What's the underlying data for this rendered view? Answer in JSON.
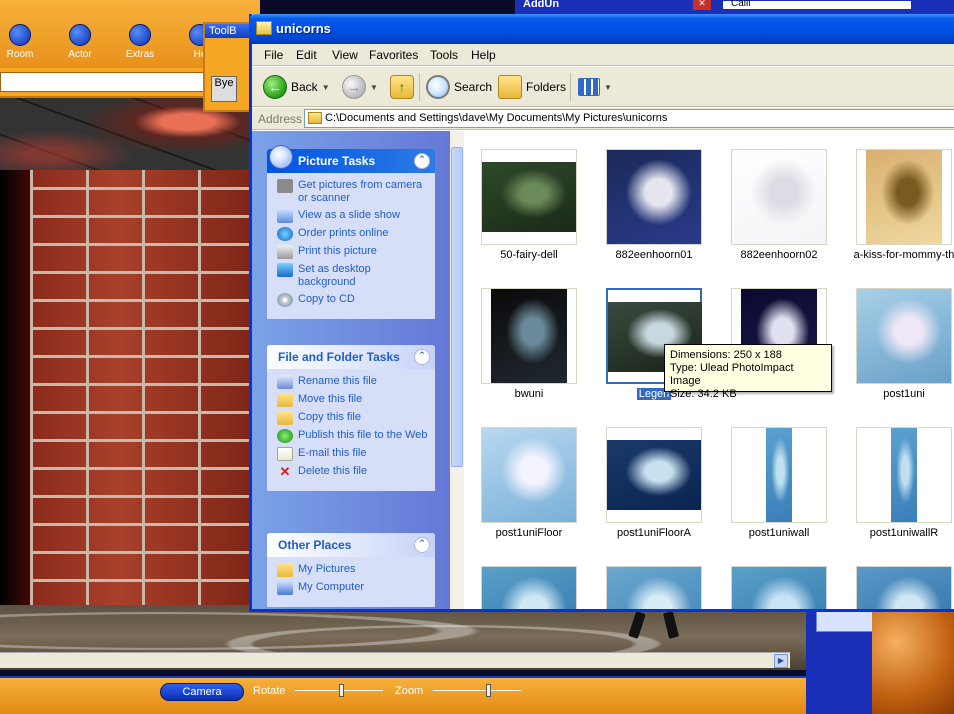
{
  "game": {
    "nav": [
      {
        "label": "Room",
        "icon": "room-icon"
      },
      {
        "label": "Actor",
        "icon": "actor-icon"
      },
      {
        "label": "Extras",
        "icon": "extras-icon"
      },
      {
        "label": "He",
        "icon": "help-icon"
      }
    ],
    "toolbar_title": "ToolB",
    "bye_label": "Bye",
    "addun_title": "AddUn",
    "calli_label": "Calli",
    "bottom": {
      "camera": "Camera",
      "rotate": "Rotate",
      "zoom": "Zoom",
      "rotate_level": 0.52,
      "zoom_level": 0.62
    }
  },
  "explorer": {
    "title": "unicorns",
    "menu": [
      "File",
      "Edit",
      "View",
      "Favorites",
      "Tools",
      "Help"
    ],
    "toolbar": {
      "back": "Back",
      "search": "Search",
      "folders": "Folders"
    },
    "address_label": "Address",
    "address_value": "C:\\Documents and Settings\\dave\\My Documents\\My Pictures\\unicorns",
    "picture_tasks": {
      "title": "Picture Tasks",
      "items": [
        {
          "label": "Get pictures from camera or scanner",
          "icon": "camera-icon"
        },
        {
          "label": "View as a slide show",
          "icon": "slideshow-icon"
        },
        {
          "label": "Order prints online",
          "icon": "globe-icon"
        },
        {
          "label": "Print this picture",
          "icon": "printer-icon"
        },
        {
          "label": "Set as desktop background",
          "icon": "desktop-icon"
        },
        {
          "label": "Copy to CD",
          "icon": "cd-icon"
        }
      ]
    },
    "file_tasks": {
      "title": "File and Folder Tasks",
      "items": [
        {
          "label": "Rename this file",
          "icon": "rename-icon"
        },
        {
          "label": "Move this file",
          "icon": "move-icon"
        },
        {
          "label": "Copy this file",
          "icon": "copy-icon"
        },
        {
          "label": "Publish this file to the Web",
          "icon": "publish-icon"
        },
        {
          "label": "E-mail this file",
          "icon": "mail-icon"
        },
        {
          "label": "Delete this file",
          "icon": "delete-icon"
        }
      ]
    },
    "other_places": {
      "title": "Other Places",
      "items": [
        {
          "label": "My Pictures",
          "icon": "my-pictures-icon"
        },
        {
          "label": "My Computer",
          "icon": "my-computer-icon"
        }
      ]
    },
    "thumbnails": [
      {
        "label": "50-fairy-dell",
        "selected": false,
        "palette": [
          "#2e4a2a",
          "#6a8a5a",
          "#1a2a18"
        ],
        "shape": "wide"
      },
      {
        "label": "882eenhoorn01",
        "selected": false,
        "palette": [
          "#1a2a5a",
          "#e6e6f0",
          "#2a3a8a"
        ],
        "shape": "full"
      },
      {
        "label": "882eenhoorn02",
        "selected": false,
        "palette": [
          "#ffffff",
          "#dcdce4",
          "#f4f4f8"
        ],
        "shape": "full"
      },
      {
        "label": "a-kiss-for-mommy-th",
        "selected": false,
        "palette": [
          "#d8b070",
          "#7a5a20",
          "#f0d8a0"
        ],
        "shape": "tall"
      },
      {
        "label": "bwuni",
        "selected": false,
        "palette": [
          "#0a0a0a",
          "#6a8a9a",
          "#202830"
        ],
        "shape": "square"
      },
      {
        "label": "Legen",
        "selected": true,
        "palette": [
          "#3a4a40",
          "#c8d8e0",
          "#1a2418"
        ],
        "shape": "wide"
      },
      {
        "label": "",
        "selected": false,
        "palette": [
          "#0a0a30",
          "#e0e0f0",
          "#1a1a4a"
        ],
        "shape": "square"
      },
      {
        "label": "post1uni",
        "selected": false,
        "palette": [
          "#a8d0e8",
          "#f0e8f8",
          "#6aa0c8"
        ],
        "shape": "full"
      },
      {
        "label": "post1uniFloor",
        "selected": false,
        "palette": [
          "#b8d8f0",
          "#f4f4ff",
          "#7ab0d8"
        ],
        "shape": "full"
      },
      {
        "label": "post1uniFloorA",
        "selected": false,
        "palette": [
          "#1a3a6a",
          "#c8e0f0",
          "#0a2450"
        ],
        "shape": "wide"
      },
      {
        "label": "post1uniwall",
        "selected": false,
        "palette": [
          "#5aa0d0",
          "#c0e0f0",
          "#3a80b8"
        ],
        "shape": "strip"
      },
      {
        "label": "post1uniwallR",
        "selected": false,
        "palette": [
          "#5aa0d0",
          "#c0e0f0",
          "#3a80b8"
        ],
        "shape": "strip"
      },
      {
        "label": "",
        "selected": false,
        "palette": [
          "#5aa0c8",
          "#d0e8f4",
          "#2a70a8"
        ],
        "shape": "full"
      },
      {
        "label": "",
        "selected": false,
        "palette": [
          "#6aa8d0",
          "#d8ecf6",
          "#3a7ab0"
        ],
        "shape": "full"
      },
      {
        "label": "",
        "selected": false,
        "palette": [
          "#5aa0c8",
          "#c8e4f4",
          "#2a70a8"
        ],
        "shape": "full"
      },
      {
        "label": "",
        "selected": false,
        "palette": [
          "#5a98c8",
          "#d0e8f4",
          "#2a6aa0"
        ],
        "shape": "full"
      }
    ],
    "tooltip": {
      "dimensions": "Dimensions: 250 x 188",
      "type": "Type: Ulead PhotoImpact Image",
      "size": "Size: 34.2 KB"
    }
  }
}
